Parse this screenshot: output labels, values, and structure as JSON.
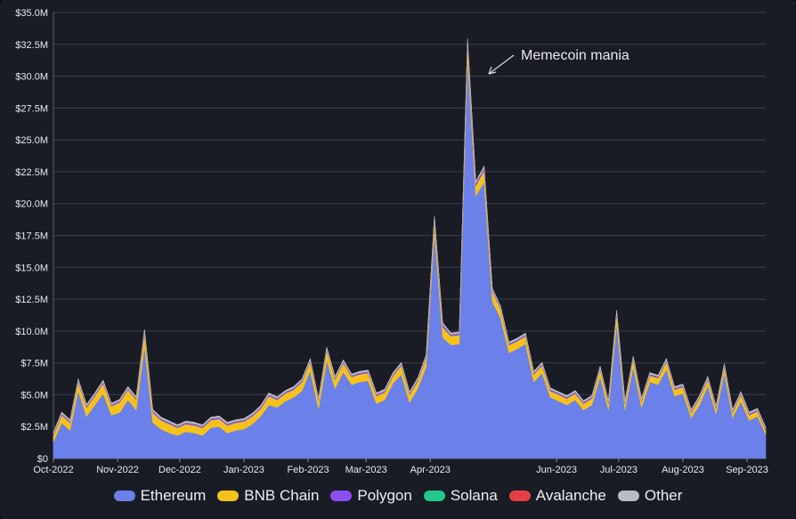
{
  "chart_data": {
    "type": "area",
    "stacked": true,
    "title": "",
    "xlabel": "",
    "ylabel": "",
    "ylim": [
      0,
      35000000
    ],
    "grid": true,
    "legend_position": "bottom-center",
    "y_ticks": [
      {
        "value": 0,
        "label": "$0"
      },
      {
        "value": 2500000,
        "label": "$2.5M"
      },
      {
        "value": 5000000,
        "label": "$5.0M"
      },
      {
        "value": 7500000,
        "label": "$7.5M"
      },
      {
        "value": 10000000,
        "label": "$10.0M"
      },
      {
        "value": 12500000,
        "label": "$12.5M"
      },
      {
        "value": 15000000,
        "label": "$15.0M"
      },
      {
        "value": 17500000,
        "label": "$17.5M"
      },
      {
        "value": 20000000,
        "label": "$20.0M"
      },
      {
        "value": 22500000,
        "label": "$22.5M"
      },
      {
        "value": 25000000,
        "label": "$25.0M"
      },
      {
        "value": 27500000,
        "label": "$27.5M"
      },
      {
        "value": 30000000,
        "label": "$30.0M"
      },
      {
        "value": 32500000,
        "label": "$32.5M"
      },
      {
        "value": 35000000,
        "label": "$35.0M"
      }
    ],
    "x_ticks": [
      {
        "date": "2022-10-01",
        "label": "Oct-2022"
      },
      {
        "date": "2022-11-01",
        "label": "Nov-2022"
      },
      {
        "date": "2022-12-01",
        "label": "Dec-2022"
      },
      {
        "date": "2023-01-01",
        "label": "Jan-2023"
      },
      {
        "date": "2023-02-01",
        "label": "Feb-2023"
      },
      {
        "date": "2023-03-01",
        "label": "Mar-2023"
      },
      {
        "date": "2023-04-01",
        "label": "Apr-2023"
      },
      {
        "date": "2023-06-01",
        "label": "Jun-2023"
      },
      {
        "date": "2023-07-01",
        "label": "Jul-2023"
      },
      {
        "date": "2023-08-01",
        "label": "Aug-2023"
      },
      {
        "date": "2023-09-01",
        "label": "Sep-2023"
      }
    ],
    "x": [
      "2022-10-01",
      "2022-10-05",
      "2022-10-09",
      "2022-10-13",
      "2022-10-17",
      "2022-10-21",
      "2022-10-25",
      "2022-10-29",
      "2022-11-02",
      "2022-11-06",
      "2022-11-10",
      "2022-11-14",
      "2022-11-18",
      "2022-11-22",
      "2022-11-26",
      "2022-11-30",
      "2022-12-04",
      "2022-12-08",
      "2022-12-12",
      "2022-12-16",
      "2022-12-20",
      "2022-12-24",
      "2022-12-28",
      "2023-01-01",
      "2023-01-05",
      "2023-01-09",
      "2023-01-13",
      "2023-01-17",
      "2023-01-21",
      "2023-01-25",
      "2023-01-29",
      "2023-02-02",
      "2023-02-06",
      "2023-02-10",
      "2023-02-14",
      "2023-02-18",
      "2023-02-22",
      "2023-02-26",
      "2023-03-02",
      "2023-03-06",
      "2023-03-10",
      "2023-03-14",
      "2023-03-18",
      "2023-03-22",
      "2023-03-26",
      "2023-03-30",
      "2023-04-03",
      "2023-04-07",
      "2023-04-11",
      "2023-04-15",
      "2023-04-19",
      "2023-04-23",
      "2023-04-27",
      "2023-05-01",
      "2023-05-05",
      "2023-05-09",
      "2023-05-13",
      "2023-05-17",
      "2023-05-21",
      "2023-05-25",
      "2023-05-29",
      "2023-06-02",
      "2023-06-06",
      "2023-06-10",
      "2023-06-14",
      "2023-06-18",
      "2023-06-22",
      "2023-06-26",
      "2023-06-30",
      "2023-07-04",
      "2023-07-08",
      "2023-07-12",
      "2023-07-16",
      "2023-07-20",
      "2023-07-24",
      "2023-07-28",
      "2023-08-01",
      "2023-08-05",
      "2023-08-09",
      "2023-08-13",
      "2023-08-17",
      "2023-08-21",
      "2023-08-25",
      "2023-08-29",
      "2023-09-02",
      "2023-09-06",
      "2023-09-10"
    ],
    "series": [
      {
        "name": "Ethereum",
        "color": "#6b80e8",
        "values": [
          1.3,
          2.8,
          2.2,
          5.3,
          3.3,
          4.2,
          5.1,
          3.4,
          3.6,
          4.6,
          3.8,
          8.8,
          2.8,
          2.3,
          2.0,
          1.8,
          2.1,
          2.0,
          1.8,
          2.4,
          2.5,
          2.0,
          2.2,
          2.3,
          2.7,
          3.3,
          4.2,
          4.0,
          4.5,
          4.8,
          5.3,
          6.9,
          3.9,
          7.7,
          5.5,
          6.8,
          5.8,
          6.0,
          6.1,
          4.3,
          4.6,
          5.9,
          6.6,
          4.4,
          5.5,
          7.2,
          17.8,
          9.5,
          8.9,
          9.0,
          31.5,
          20.6,
          21.7,
          12.3,
          11.0,
          8.3,
          8.6,
          9.0,
          6.0,
          6.7,
          4.8,
          4.5,
          4.2,
          4.6,
          3.8,
          4.2,
          6.4,
          3.8,
          10.6,
          3.8,
          7.2,
          4.0,
          6.0,
          5.8,
          7.0,
          4.9,
          5.1,
          3.2,
          4.2,
          5.7,
          3.5,
          6.7,
          3.2,
          4.5,
          3.0,
          3.3,
          1.9
        ]
      },
      {
        "name": "BNB Chain",
        "color": "#f5c21b",
        "values": [
          0.5,
          0.6,
          0.6,
          0.7,
          0.7,
          0.7,
          0.8,
          0.7,
          0.8,
          0.8,
          0.8,
          1.0,
          0.8,
          0.7,
          0.7,
          0.6,
          0.6,
          0.6,
          0.6,
          0.6,
          0.6,
          0.6,
          0.6,
          0.6,
          0.6,
          0.6,
          0.7,
          0.6,
          0.6,
          0.6,
          0.7,
          0.7,
          0.6,
          0.8,
          0.7,
          0.7,
          0.6,
          0.6,
          0.6,
          0.6,
          0.6,
          0.6,
          0.7,
          0.6,
          0.6,
          0.7,
          0.9,
          0.8,
          0.7,
          0.7,
          1.0,
          0.8,
          0.9,
          0.8,
          0.7,
          0.6,
          0.6,
          0.6,
          0.6,
          0.6,
          0.5,
          0.5,
          0.5,
          0.5,
          0.5,
          0.5,
          0.6,
          0.5,
          0.8,
          0.5,
          0.6,
          0.5,
          0.5,
          0.5,
          0.6,
          0.5,
          0.5,
          0.4,
          0.5,
          0.5,
          0.4,
          0.5,
          0.4,
          0.5,
          0.4,
          0.4,
          0.3
        ]
      },
      {
        "name": "Polygon",
        "color": "#8b4ef0",
        "values": [
          0.1,
          0.1,
          0.1,
          0.1,
          0.1,
          0.1,
          0.1,
          0.1,
          0.1,
          0.1,
          0.1,
          0.2,
          0.1,
          0.1,
          0.1,
          0.1,
          0.1,
          0.1,
          0.1,
          0.1,
          0.1,
          0.1,
          0.1,
          0.1,
          0.1,
          0.1,
          0.1,
          0.1,
          0.1,
          0.1,
          0.1,
          0.1,
          0.1,
          0.1,
          0.1,
          0.1,
          0.1,
          0.1,
          0.1,
          0.1,
          0.1,
          0.1,
          0.1,
          0.1,
          0.1,
          0.1,
          0.2,
          0.2,
          0.1,
          0.1,
          0.2,
          0.2,
          0.2,
          0.1,
          0.1,
          0.1,
          0.1,
          0.1,
          0.1,
          0.1,
          0.1,
          0.1,
          0.1,
          0.1,
          0.1,
          0.1,
          0.1,
          0.1,
          0.1,
          0.1,
          0.1,
          0.1,
          0.1,
          0.1,
          0.1,
          0.1,
          0.1,
          0.1,
          0.1,
          0.1,
          0.1,
          0.1,
          0.1,
          0.1,
          0.1,
          0.1,
          0.1
        ]
      },
      {
        "name": "Solana",
        "color": "#21c98b",
        "values": [
          0.02,
          0.02,
          0.02,
          0.02,
          0.02,
          0.02,
          0.02,
          0.02,
          0.02,
          0.02,
          0.02,
          0.02,
          0.02,
          0.02,
          0.02,
          0.02,
          0.02,
          0.02,
          0.02,
          0.02,
          0.02,
          0.02,
          0.02,
          0.02,
          0.02,
          0.02,
          0.02,
          0.02,
          0.02,
          0.02,
          0.02,
          0.02,
          0.02,
          0.02,
          0.02,
          0.02,
          0.02,
          0.02,
          0.02,
          0.02,
          0.02,
          0.02,
          0.02,
          0.02,
          0.02,
          0.02,
          0.02,
          0.02,
          0.02,
          0.02,
          0.03,
          0.02,
          0.02,
          0.02,
          0.02,
          0.02,
          0.02,
          0.02,
          0.02,
          0.02,
          0.02,
          0.02,
          0.02,
          0.02,
          0.02,
          0.02,
          0.02,
          0.02,
          0.02,
          0.02,
          0.02,
          0.02,
          0.02,
          0.02,
          0.02,
          0.02,
          0.02,
          0.02,
          0.02,
          0.02,
          0.02,
          0.02,
          0.02,
          0.02,
          0.02,
          0.02,
          0.02
        ]
      },
      {
        "name": "Avalanche",
        "color": "#e5404a",
        "values": [
          0.02,
          0.02,
          0.02,
          0.02,
          0.02,
          0.02,
          0.02,
          0.02,
          0.02,
          0.02,
          0.02,
          0.02,
          0.02,
          0.02,
          0.02,
          0.02,
          0.02,
          0.02,
          0.02,
          0.02,
          0.02,
          0.02,
          0.02,
          0.02,
          0.02,
          0.02,
          0.02,
          0.02,
          0.02,
          0.02,
          0.02,
          0.02,
          0.02,
          0.02,
          0.02,
          0.02,
          0.02,
          0.02,
          0.02,
          0.02,
          0.02,
          0.02,
          0.02,
          0.02,
          0.02,
          0.02,
          0.02,
          0.02,
          0.02,
          0.02,
          0.03,
          0.02,
          0.02,
          0.02,
          0.02,
          0.02,
          0.02,
          0.02,
          0.02,
          0.02,
          0.02,
          0.02,
          0.02,
          0.02,
          0.02,
          0.02,
          0.02,
          0.02,
          0.02,
          0.02,
          0.02,
          0.02,
          0.02,
          0.02,
          0.02,
          0.02,
          0.02,
          0.02,
          0.02,
          0.02,
          0.02,
          0.02,
          0.02,
          0.02,
          0.02,
          0.02,
          0.02
        ]
      },
      {
        "name": "Other",
        "color": "#b9bcc4",
        "values": [
          0.1,
          0.1,
          0.1,
          0.1,
          0.1,
          0.1,
          0.1,
          0.1,
          0.1,
          0.1,
          0.1,
          0.1,
          0.1,
          0.1,
          0.1,
          0.1,
          0.1,
          0.1,
          0.1,
          0.1,
          0.1,
          0.1,
          0.1,
          0.1,
          0.1,
          0.1,
          0.1,
          0.1,
          0.1,
          0.1,
          0.1,
          0.1,
          0.1,
          0.1,
          0.1,
          0.1,
          0.1,
          0.1,
          0.1,
          0.1,
          0.1,
          0.1,
          0.1,
          0.1,
          0.1,
          0.1,
          0.1,
          0.1,
          0.1,
          0.1,
          0.2,
          0.1,
          0.1,
          0.1,
          0.1,
          0.1,
          0.1,
          0.1,
          0.1,
          0.1,
          0.1,
          0.1,
          0.1,
          0.1,
          0.1,
          0.1,
          0.1,
          0.1,
          0.1,
          0.1,
          0.1,
          0.1,
          0.1,
          0.1,
          0.1,
          0.1,
          0.1,
          0.1,
          0.1,
          0.1,
          0.1,
          0.1,
          0.1,
          0.1,
          0.1,
          0.1,
          0.1
        ]
      }
    ],
    "value_unit_scale": 1000000,
    "annotations": [
      {
        "text": "Memecoin mania",
        "date": "2023-04-19"
      }
    ]
  }
}
